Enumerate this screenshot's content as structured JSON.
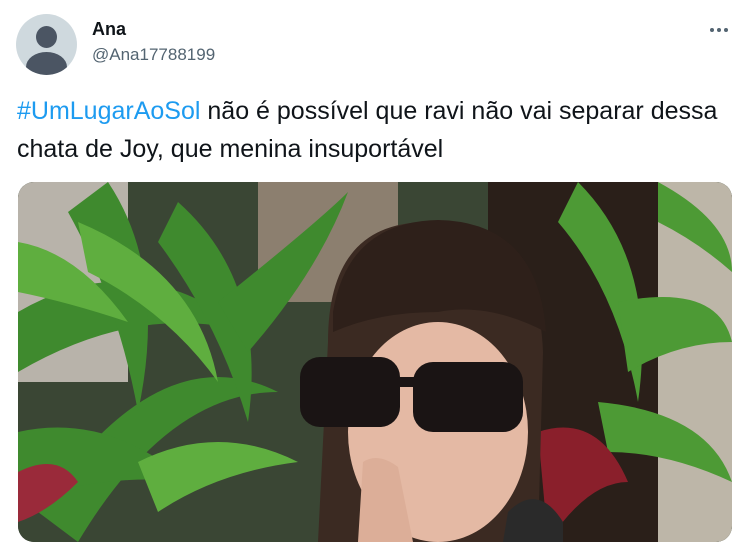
{
  "author": {
    "name": "Ana",
    "handle": "@Ana17788199"
  },
  "tweet": {
    "hashtag": "#UmLugarAoSol",
    "text": " não é possível que ravi não vai separar dessa chata de Joy, que menina insuportável"
  },
  "media": {
    "description_icon": "photo"
  },
  "colors": {
    "link": "#1d9bf0",
    "text": "#0f1419",
    "secondary": "#536471"
  }
}
